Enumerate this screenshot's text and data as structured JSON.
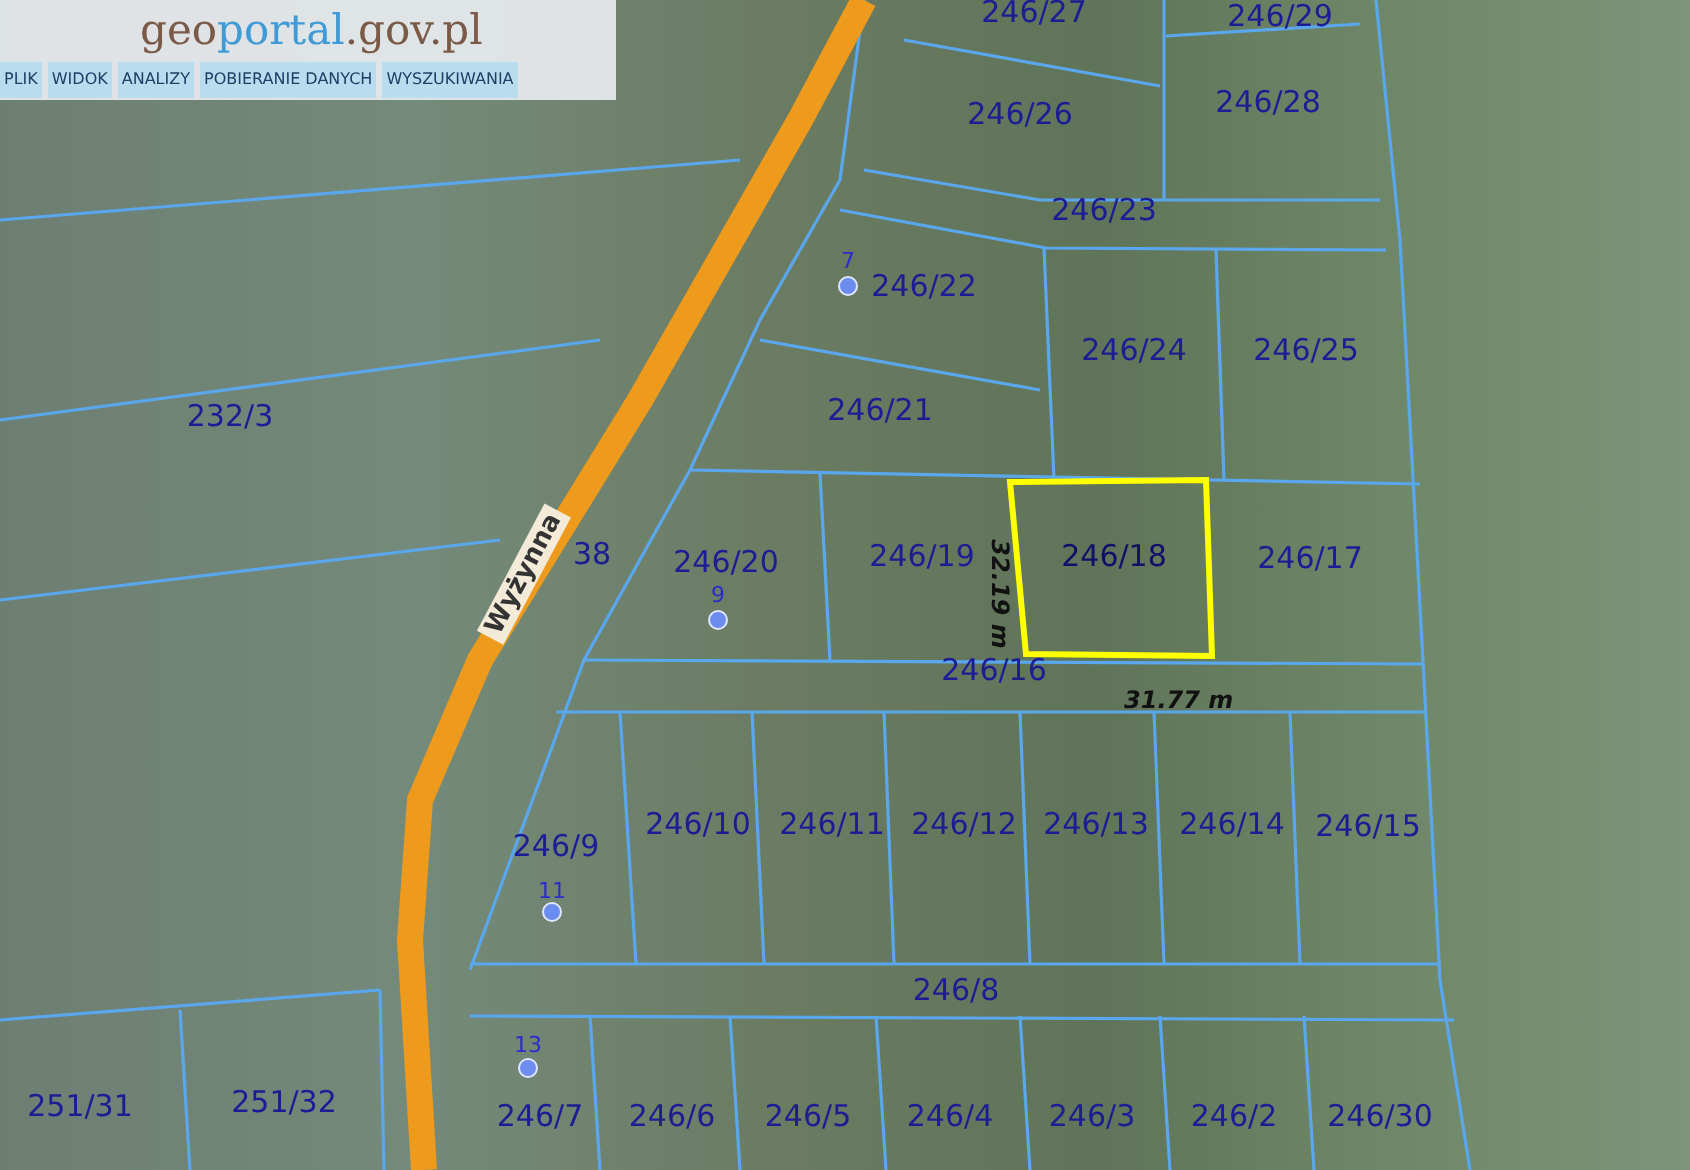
{
  "header": {
    "logo": {
      "accent": "geo",
      "main": "portal",
      "suffix": ".gov.pl"
    },
    "menu": [
      {
        "label": "PLIK"
      },
      {
        "label": "WIDOK"
      },
      {
        "label": "ANALIZY"
      },
      {
        "label": "POBIERANIE DANYCH"
      },
      {
        "label": "WYSZUKIWANIA"
      }
    ]
  },
  "map": {
    "street": "Wyżynna",
    "parcels": [
      {
        "label": "246/27",
        "selected": false
      },
      {
        "label": "246/29",
        "selected": false
      },
      {
        "label": "246/26",
        "selected": false
      },
      {
        "label": "246/28",
        "selected": false
      },
      {
        "label": "246/23",
        "selected": false
      },
      {
        "label": "246/22",
        "selected": false
      },
      {
        "label": "246/24",
        "selected": false
      },
      {
        "label": "246/25",
        "selected": false
      },
      {
        "label": "232/3",
        "selected": false
      },
      {
        "label": "246/21",
        "selected": false
      },
      {
        "label": "38",
        "selected": false
      },
      {
        "label": "246/20",
        "selected": false
      },
      {
        "label": "246/19",
        "selected": false
      },
      {
        "label": "246/18",
        "selected": true
      },
      {
        "label": "246/17",
        "selected": false
      },
      {
        "label": "246/16",
        "selected": false
      },
      {
        "label": "246/9",
        "selected": false
      },
      {
        "label": "246/10",
        "selected": false
      },
      {
        "label": "246/11",
        "selected": false
      },
      {
        "label": "246/12",
        "selected": false
      },
      {
        "label": "246/13",
        "selected": false
      },
      {
        "label": "246/14",
        "selected": false
      },
      {
        "label": "246/15",
        "selected": false
      },
      {
        "label": "246/8",
        "selected": false
      },
      {
        "label": "251/31",
        "selected": false
      },
      {
        "label": "251/32",
        "selected": false
      },
      {
        "label": "246/7",
        "selected": false
      },
      {
        "label": "246/6",
        "selected": false
      },
      {
        "label": "246/5",
        "selected": false
      },
      {
        "label": "246/4",
        "selected": false
      },
      {
        "label": "246/3",
        "selected": false
      },
      {
        "label": "246/2",
        "selected": false
      },
      {
        "label": "246/30",
        "selected": false
      }
    ],
    "points": [
      {
        "label": "7"
      },
      {
        "label": "9"
      },
      {
        "label": "11"
      },
      {
        "label": "13"
      }
    ],
    "measurements": [
      {
        "kind": "vertical",
        "label": "32.19 m"
      },
      {
        "kind": "horizontal",
        "label": "31.77 m"
      }
    ]
  }
}
